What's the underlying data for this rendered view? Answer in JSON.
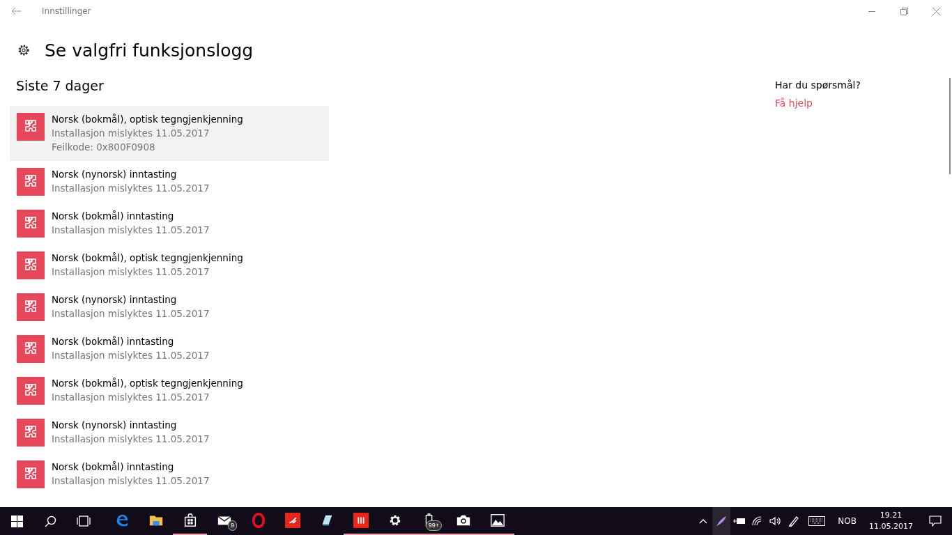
{
  "window": {
    "title": "Innstillinger"
  },
  "page": {
    "title": "Se valgfri funksjonslogg"
  },
  "section": {
    "title": "Siste 7 dager"
  },
  "items": [
    {
      "name": "Norsk (bokmål), optisk tegngjenkjenning",
      "status": "Installasjon mislyktes 11.05.2017",
      "error": "Feilkode: 0x800F0908",
      "selected": true
    },
    {
      "name": "Norsk (nynorsk) inntasting",
      "status": "Installasjon mislyktes 11.05.2017",
      "selected": false
    },
    {
      "name": "Norsk (bokmål) inntasting",
      "status": "Installasjon mislyktes 11.05.2017",
      "selected": false
    },
    {
      "name": "Norsk (bokmål), optisk tegngjenkjenning",
      "status": "Installasjon mislyktes 11.05.2017",
      "selected": false
    },
    {
      "name": "Norsk (nynorsk) inntasting",
      "status": "Installasjon mislyktes 11.05.2017",
      "selected": false
    },
    {
      "name": "Norsk (bokmål) inntasting",
      "status": "Installasjon mislyktes 11.05.2017",
      "selected": false
    },
    {
      "name": "Norsk (bokmål), optisk tegngjenkjenning",
      "status": "Installasjon mislyktes 11.05.2017",
      "selected": false
    },
    {
      "name": "Norsk (nynorsk) inntasting",
      "status": "Installasjon mislyktes 11.05.2017",
      "selected": false
    },
    {
      "name": "Norsk (bokmål) inntasting",
      "status": "Installasjon mislyktes 11.05.2017",
      "selected": false
    }
  ],
  "help": {
    "question": "Har du spørsmål?",
    "link": "Få hjelp"
  },
  "taskbar": {
    "apps": [
      {
        "kind": "edge",
        "running": false
      },
      {
        "kind": "folder",
        "running": false
      },
      {
        "kind": "store",
        "running": true
      },
      {
        "kind": "mail",
        "running": false,
        "badge": "9"
      },
      {
        "kind": "opera",
        "running": false
      },
      {
        "kind": "red",
        "running": false
      },
      {
        "kind": "notepad",
        "running": false
      },
      {
        "kind": "bars",
        "running": true
      },
      {
        "kind": "settings",
        "running": true
      },
      {
        "kind": "battery",
        "running": true,
        "badge": "99+"
      },
      {
        "kind": "camera",
        "running": true
      },
      {
        "kind": "photos",
        "running": true
      }
    ],
    "language": "NOB",
    "time": "19.21",
    "date": "11.05.2017"
  }
}
